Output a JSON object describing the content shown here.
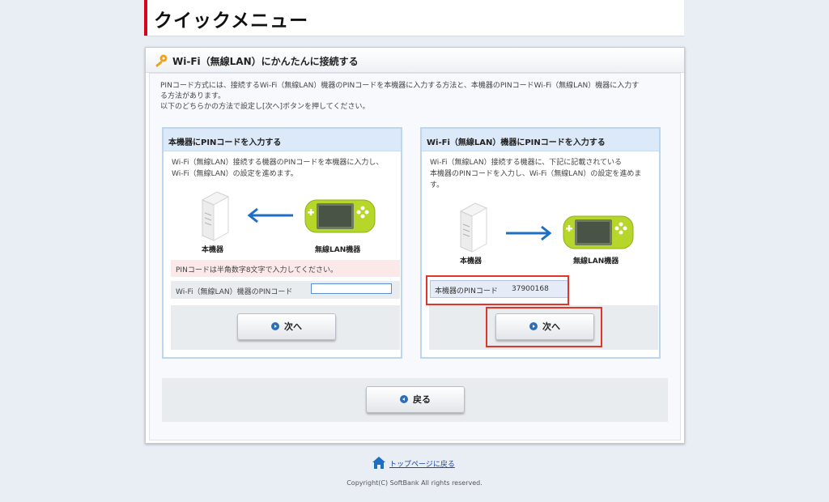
{
  "page": {
    "title": "クイックメニュー",
    "section_title": "Wi-Fi（無線LAN）にかんたんに接続する",
    "intro_lines": [
      "PINコード方式には、接続するWi-Fi（無線LAN）機器のPINコードを本機器に入力する方法と、本機器のPINコードWi-Fi（無線LAN）機器に入力す",
      "る方法があります。",
      "以下のどちらかの方法で設定し[次へ]ボタンを押してください。"
    ]
  },
  "left_box": {
    "heading": "本機器にPINコードを入力する",
    "desc_lines": [
      "Wi-Fi（無線LAN）接続する機器のPINコードを本機器に入力し、",
      "Wi-Fi（無線LAN）の設定を進めます。"
    ],
    "device_a_label": "本機器",
    "device_b_label": "無線LAN機器",
    "pin_note": "PINコードは半角数字8文字で入力してください。",
    "pin_input_label": "Wi-Fi（無線LAN）機器のPINコード",
    "pin_input_value": "",
    "next_label": "次へ"
  },
  "right_box": {
    "heading": "Wi-Fi（無線LAN）機器にPINコードを入力する",
    "desc_lines": [
      "Wi-Fi（無線LAN）接続する機器に、下記に記載されている",
      "本機器のPINコードを入力し、Wi-Fi（無線LAN）の設定を進めま",
      "す。"
    ],
    "device_a_label": "本機器",
    "device_b_label": "無線LAN機器",
    "pin_label": "本機器のPINコード",
    "pin_value": "37900168",
    "next_label": "次へ"
  },
  "back_label": "戻る",
  "footer": {
    "top_link": "トップページに戻る",
    "copyright": "Copyright(C) SoftBank All rights reserved."
  },
  "colors": {
    "accent_red": "#d8001c",
    "highlight_frame": "#e0352b",
    "arrow_blue": "#1e6fc4",
    "device_green": "#b6d72a"
  },
  "icons": {
    "section": "key-icon",
    "next": "play-circle-icon",
    "back": "back-circle-icon",
    "home": "home-icon"
  }
}
